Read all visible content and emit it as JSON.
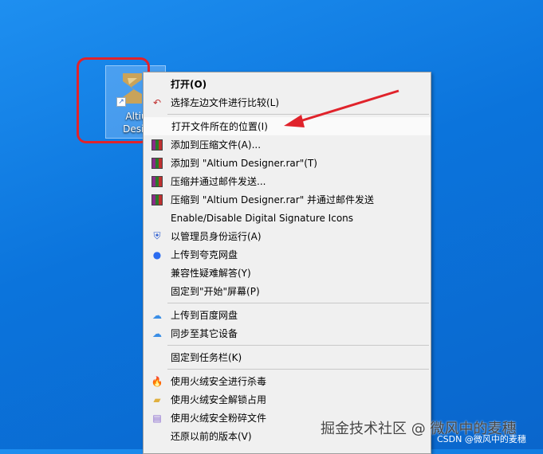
{
  "desktop": {
    "icon_label_line1": "Altiu",
    "icon_label_line2": "Desig"
  },
  "menu": {
    "items": [
      {
        "label": "打开(O)",
        "icon": "none",
        "bold": true
      },
      {
        "label": "选择左边文件进行比较(L)",
        "icon": "compare-icon"
      },
      {
        "label": "打开文件所在的位置(I)",
        "icon": "none",
        "highlighted": true
      },
      {
        "label": "添加到压缩文件(A)...",
        "icon": "winrar-icon"
      },
      {
        "label": "添加到 \"Altium Designer.rar\"(T)",
        "icon": "winrar-icon"
      },
      {
        "label": "压缩并通过邮件发送...",
        "icon": "winrar-icon"
      },
      {
        "label": "压缩到 \"Altium Designer.rar\" 并通过邮件发送",
        "icon": "winrar-icon"
      },
      {
        "label": "Enable/Disable Digital Signature Icons",
        "icon": "none"
      },
      {
        "label": "以管理员身份运行(A)",
        "icon": "shield-icon"
      },
      {
        "label": "上传到夸克网盘",
        "icon": "quark-icon"
      },
      {
        "label": "兼容性疑难解答(Y)",
        "icon": "none"
      },
      {
        "label": "固定到\"开始\"屏幕(P)",
        "icon": "none"
      },
      {
        "label": "上传到百度网盘",
        "icon": "baidu-cloud-icon"
      },
      {
        "label": "同步至其它设备",
        "icon": "baidu-cloud-icon"
      },
      {
        "label": "固定到任务栏(K)",
        "icon": "none"
      },
      {
        "label": "使用火绒安全进行杀毒",
        "icon": "huorong-icon"
      },
      {
        "label": "使用火绒安全解锁占用",
        "icon": "folder-unlock-icon"
      },
      {
        "label": "使用火绒安全粉碎文件",
        "icon": "shredder-icon"
      },
      {
        "label": "还原以前的版本(V)",
        "icon": "none"
      }
    ]
  },
  "watermark": {
    "main": "掘金技术社区 @ 微风中的麦穗",
    "csdn": "CSDN @微风中的麦穗"
  },
  "colors": {
    "highlight_box": "#e0232b",
    "arrow": "#e0232b"
  }
}
